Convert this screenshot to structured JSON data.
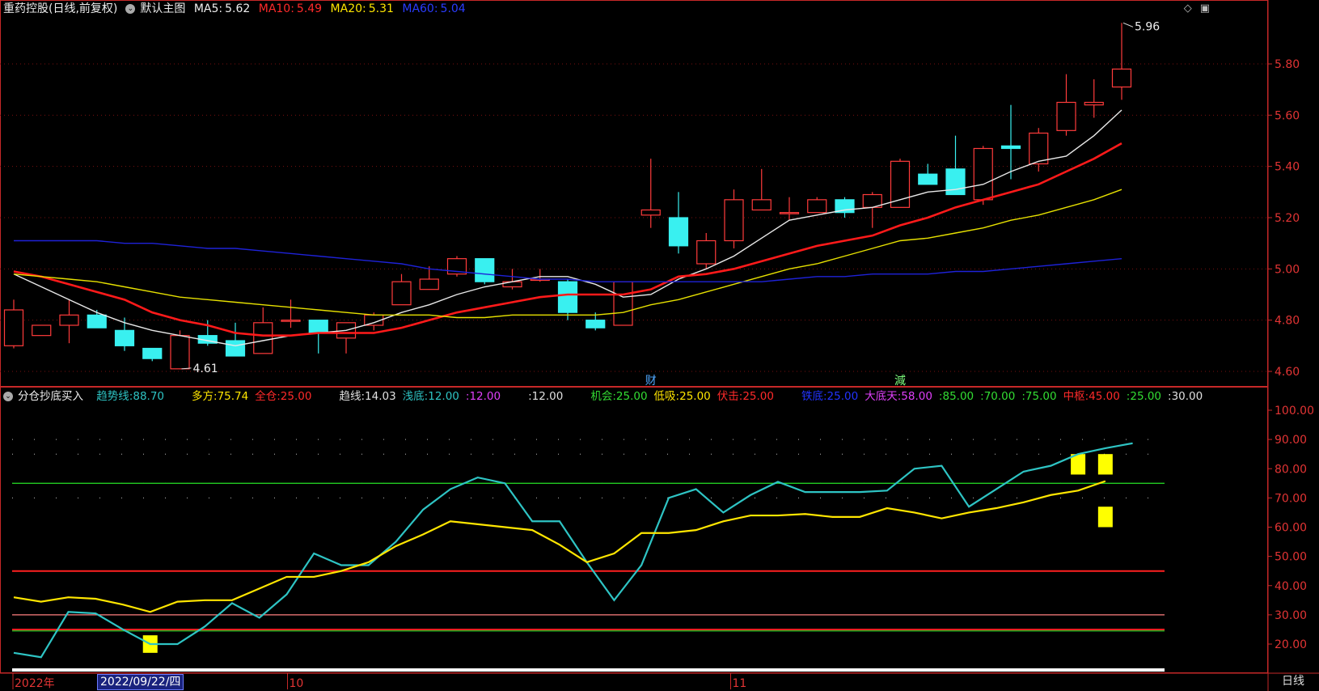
{
  "header": {
    "stock_name": "重药控股",
    "period_mode": "(日线,前复权)",
    "main_chart": "默认主图",
    "ma5_label": "MA5:",
    "ma5_value": "5.62",
    "ma10_label": "MA10:",
    "ma10_value": "5.49",
    "ma20_label": "MA20:",
    "ma20_value": "5.31",
    "ma60_label": "MA60:",
    "ma60_value": "5.04",
    "top_icons": [
      "diamond-icon",
      "window-icon"
    ]
  },
  "indicator_header": {
    "name": "分仓抄底买入",
    "items": [
      {
        "label": "趋势线:",
        "value": "88.70",
        "color": "#2ec4c4"
      },
      {
        "label": "多方:",
        "value": "75.74",
        "color": "#ffe600"
      },
      {
        "label": "全仓:",
        "value": "25.00",
        "color": "#ff2a2a"
      },
      {
        "label": "趋线:",
        "value": "14.03",
        "color": "#e0e0e0"
      },
      {
        "label": "浅底:",
        "value": "12.00",
        "color": "#2ec4c4"
      },
      {
        "label": ":",
        "value": "12.00",
        "color": "#e040fb"
      },
      {
        "label": ":",
        "value": "12.00",
        "color": "#e0e0e0"
      },
      {
        "label": "机会:",
        "value": "25.00",
        "color": "#33dd33"
      },
      {
        "label": "低吸:",
        "value": "25.00",
        "color": "#ffe600"
      },
      {
        "label": "伏击:",
        "value": "25.00",
        "color": "#ff2a2a"
      },
      {
        "label": "铁底:",
        "value": "25.00",
        "color": "#2233ff"
      },
      {
        "label": "大底天:",
        "value": "58.00",
        "color": "#e040fb"
      },
      {
        "label": ":",
        "value": "85.00",
        "color": "#33dd33"
      },
      {
        "label": ":",
        "value": "70.00",
        "color": "#33dd33"
      },
      {
        "label": ":",
        "value": "75.00",
        "color": "#33dd33"
      },
      {
        "label": "中枢:",
        "value": "45.00",
        "color": "#ff2a2a"
      },
      {
        "label": ":",
        "value": "25.00",
        "color": "#33dd33"
      },
      {
        "label": ":",
        "value": "30.00",
        "color": "#e0e0e0"
      }
    ]
  },
  "bottom_axis": {
    "labels": [
      {
        "text": "2022年",
        "x_index": 0
      },
      {
        "text": "10",
        "x_index": 10
      },
      {
        "text": "11",
        "x_index": 26
      }
    ],
    "selected_date": "2022/09/22/四",
    "period_button": "日线"
  },
  "chart_data": [
    {
      "type": "candlestick",
      "price_axis": {
        "min": 4.6,
        "max": 5.8,
        "ticks": [
          4.6,
          4.8,
          5.0,
          5.2,
          5.4,
          5.6,
          5.8
        ]
      },
      "annotations": [
        {
          "text": "5.96",
          "candle_index": 40
        },
        {
          "text": "4.61",
          "candle_index": 6
        },
        {
          "text": "财",
          "candle_index": 23
        },
        {
          "text": "減",
          "candle_index": 32
        }
      ],
      "candles": [
        {
          "o": 4.7,
          "h": 4.88,
          "l": 4.69,
          "c": 4.84
        },
        {
          "o": 4.74,
          "h": 4.78,
          "l": 4.74,
          "c": 4.78
        },
        {
          "o": 4.78,
          "h": 4.88,
          "l": 4.71,
          "c": 4.82
        },
        {
          "o": 4.82,
          "h": 4.84,
          "l": 4.77,
          "c": 4.77
        },
        {
          "o": 4.76,
          "h": 4.81,
          "l": 4.68,
          "c": 4.7
        },
        {
          "o": 4.69,
          "h": 4.69,
          "l": 4.64,
          "c": 4.65
        },
        {
          "o": 4.61,
          "h": 4.76,
          "l": 4.61,
          "c": 4.74
        },
        {
          "o": 4.74,
          "h": 4.8,
          "l": 4.7,
          "c": 4.71
        },
        {
          "o": 4.72,
          "h": 4.79,
          "l": 4.66,
          "c": 4.66
        },
        {
          "o": 4.67,
          "h": 4.85,
          "l": 4.67,
          "c": 4.79
        },
        {
          "o": 4.8,
          "h": 4.88,
          "l": 4.77,
          "c": 4.8
        },
        {
          "o": 4.8,
          "h": 4.8,
          "l": 4.67,
          "c": 4.75
        },
        {
          "o": 4.73,
          "h": 4.79,
          "l": 4.67,
          "c": 4.79
        },
        {
          "o": 4.78,
          "h": 4.83,
          "l": 4.76,
          "c": 4.82
        },
        {
          "o": 4.86,
          "h": 4.98,
          "l": 4.86,
          "c": 4.95
        },
        {
          "o": 4.92,
          "h": 5.01,
          "l": 4.92,
          "c": 4.96
        },
        {
          "o": 4.98,
          "h": 5.05,
          "l": 4.97,
          "c": 5.04
        },
        {
          "o": 5.04,
          "h": 5.04,
          "l": 4.94,
          "c": 4.95
        },
        {
          "o": 4.93,
          "h": 5.0,
          "l": 4.92,
          "c": 4.95
        },
        {
          "o": 4.96,
          "h": 5.0,
          "l": 4.95,
          "c": 4.96
        },
        {
          "o": 4.95,
          "h": 4.96,
          "l": 4.8,
          "c": 4.83
        },
        {
          "o": 4.8,
          "h": 4.83,
          "l": 4.76,
          "c": 4.77
        },
        {
          "o": 4.78,
          "h": 4.95,
          "l": 4.78,
          "c": 4.95
        },
        {
          "o": 5.21,
          "h": 5.43,
          "l": 5.16,
          "c": 5.23
        },
        {
          "o": 5.2,
          "h": 5.3,
          "l": 5.06,
          "c": 5.09
        },
        {
          "o": 5.02,
          "h": 5.14,
          "l": 5.0,
          "c": 5.11
        },
        {
          "o": 5.11,
          "h": 5.31,
          "l": 5.08,
          "c": 5.27
        },
        {
          "o": 5.23,
          "h": 5.39,
          "l": 5.23,
          "c": 5.27
        },
        {
          "o": 5.22,
          "h": 5.28,
          "l": 5.19,
          "c": 5.22
        },
        {
          "o": 5.22,
          "h": 5.28,
          "l": 5.22,
          "c": 5.27
        },
        {
          "o": 5.27,
          "h": 5.28,
          "l": 5.2,
          "c": 5.22
        },
        {
          "o": 5.24,
          "h": 5.3,
          "l": 5.16,
          "c": 5.29
        },
        {
          "o": 5.24,
          "h": 5.43,
          "l": 5.24,
          "c": 5.42
        },
        {
          "o": 5.37,
          "h": 5.41,
          "l": 5.33,
          "c": 5.33
        },
        {
          "o": 5.39,
          "h": 5.52,
          "l": 5.29,
          "c": 5.29
        },
        {
          "o": 5.27,
          "h": 5.48,
          "l": 5.25,
          "c": 5.47
        },
        {
          "o": 5.48,
          "h": 5.64,
          "l": 5.35,
          "c": 5.47
        },
        {
          "o": 5.41,
          "h": 5.55,
          "l": 5.38,
          "c": 5.53
        },
        {
          "o": 5.54,
          "h": 5.76,
          "l": 5.52,
          "c": 5.65
        },
        {
          "o": 5.64,
          "h": 5.74,
          "l": 5.59,
          "c": 5.65
        },
        {
          "o": 5.71,
          "h": 5.96,
          "l": 5.66,
          "c": 5.78
        }
      ],
      "series": [
        {
          "name": "MA5",
          "color": "#e8e8e8",
          "values": [
            4.98,
            4.93,
            4.88,
            4.83,
            4.79,
            4.76,
            4.74,
            4.72,
            4.7,
            4.72,
            4.74,
            4.75,
            4.76,
            4.79,
            4.83,
            4.86,
            4.9,
            4.93,
            4.95,
            4.97,
            4.97,
            4.94,
            4.89,
            4.9,
            4.96,
            5.0,
            5.05,
            5.12,
            5.19,
            5.21,
            5.23,
            5.24,
            5.27,
            5.3,
            5.31,
            5.33,
            5.38,
            5.42,
            5.44,
            5.52,
            5.62
          ]
        },
        {
          "name": "MA10",
          "color": "#ff1a1a",
          "values": [
            4.99,
            4.97,
            4.94,
            4.91,
            4.88,
            4.83,
            4.8,
            4.78,
            4.75,
            4.74,
            4.74,
            4.75,
            4.75,
            4.75,
            4.77,
            4.8,
            4.83,
            4.85,
            4.87,
            4.89,
            4.9,
            4.9,
            4.9,
            4.92,
            4.97,
            4.98,
            5.0,
            5.03,
            5.06,
            5.09,
            5.11,
            5.13,
            5.17,
            5.2,
            5.24,
            5.27,
            5.3,
            5.33,
            5.38,
            5.43,
            5.49
          ]
        },
        {
          "name": "MA20",
          "color": "#e6e000",
          "values": [
            4.98,
            4.97,
            4.96,
            4.95,
            4.93,
            4.91,
            4.89,
            4.88,
            4.87,
            4.86,
            4.85,
            4.84,
            4.83,
            4.82,
            4.82,
            4.82,
            4.81,
            4.81,
            4.82,
            4.82,
            4.82,
            4.82,
            4.83,
            4.86,
            4.88,
            4.91,
            4.94,
            4.97,
            5.0,
            5.02,
            5.05,
            5.08,
            5.11,
            5.12,
            5.14,
            5.16,
            5.19,
            5.21,
            5.24,
            5.27,
            5.31
          ]
        },
        {
          "name": "MA60",
          "color": "#1e22d8",
          "values": [
            5.11,
            5.11,
            5.11,
            5.11,
            5.1,
            5.1,
            5.09,
            5.08,
            5.08,
            5.07,
            5.06,
            5.05,
            5.04,
            5.03,
            5.02,
            5.0,
            4.99,
            4.98,
            4.97,
            4.96,
            4.96,
            4.95,
            4.95,
            4.95,
            4.95,
            4.95,
            4.95,
            4.95,
            4.96,
            4.97,
            4.97,
            4.98,
            4.98,
            4.98,
            4.99,
            4.99,
            5.0,
            5.01,
            5.02,
            5.03,
            5.04
          ]
        }
      ]
    },
    {
      "type": "line",
      "title": "分仓抄底买入",
      "value_axis": {
        "min": 15,
        "max": 100,
        "ticks": [
          20.0,
          30.0,
          40.0,
          50.0,
          60.0,
          70.0,
          80.0,
          90.0,
          100.0
        ]
      },
      "horizontal_lines": [
        {
          "value": 75,
          "color": "#22cc22"
        },
        {
          "value": 45,
          "color": "#ff2020"
        },
        {
          "value": 30,
          "color": "#ff8080"
        },
        {
          "value": 25,
          "color": "#ff2020"
        },
        {
          "value": 24.5,
          "color": "#22cc22"
        }
      ],
      "dotted_lines": [
        85,
        70,
        75,
        90
      ],
      "series": [
        {
          "name": "趋势线",
          "color": "#2ec4c4",
          "values": [
            17,
            15.5,
            31,
            30.5,
            25,
            20,
            20,
            26,
            34,
            29,
            37,
            51,
            47,
            47,
            55,
            66,
            73,
            77,
            75,
            62,
            62,
            48,
            35,
            47,
            70,
            73,
            65,
            71,
            75.5,
            72,
            72,
            72,
            72.5,
            80,
            81,
            67,
            73,
            79,
            81,
            85,
            87,
            88.7
          ]
        },
        {
          "name": "多方",
          "color": "#ffe600",
          "values": [
            36,
            34.5,
            36,
            35.5,
            33.5,
            31,
            34.5,
            35,
            35,
            39,
            43,
            43,
            45,
            48,
            53.5,
            57.5,
            62,
            61,
            60,
            59,
            54,
            48,
            51,
            58,
            58,
            59,
            62,
            64,
            64,
            64.5,
            63.5,
            63.5,
            66.5,
            65,
            63,
            65,
            66.5,
            68.5,
            71,
            72.5,
            75.74
          ]
        }
      ],
      "signal_bars": [
        {
          "index": 5,
          "from": 17,
          "to": 23
        },
        {
          "index": 39,
          "from": 78,
          "to": 85
        },
        {
          "index": 40,
          "from": 78,
          "to": 85
        },
        {
          "index": 40,
          "from": 60,
          "to": 67
        }
      ]
    }
  ]
}
